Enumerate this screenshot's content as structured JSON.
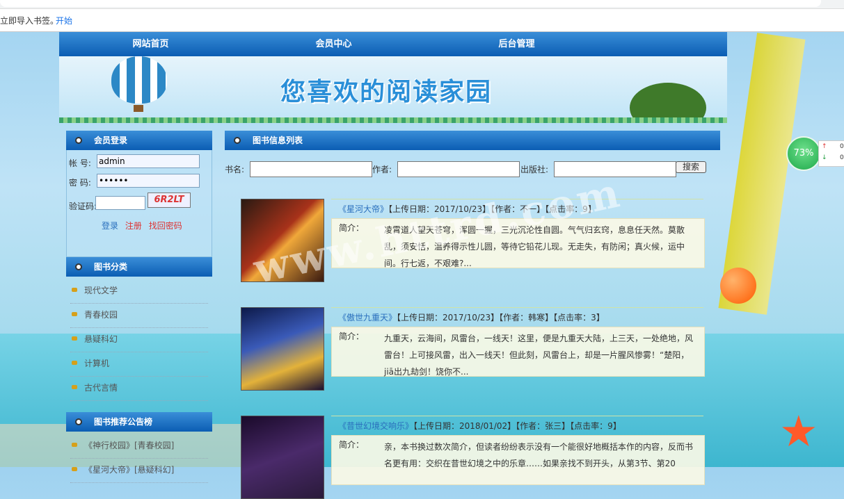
{
  "browser": {
    "bookmark_hint": "立即导入书签。",
    "bookmark_start": "开始"
  },
  "nav": [
    "网站首页",
    "会员中心",
    "后台管理"
  ],
  "banner": {
    "title": "您喜欢的阅读家园"
  },
  "login": {
    "panel_title": "会员登录",
    "account_label": "帐 号:",
    "account_value": "admin",
    "password_label": "密 码:",
    "password_value": "••••••",
    "captcha_label": "验证码:",
    "captcha_text": "6R2LT",
    "login_link": "登录",
    "register_link": "注册",
    "recover_link": "找回密码"
  },
  "categories": {
    "panel_title": "图书分类",
    "items": [
      "现代文学",
      "青春校园",
      "悬疑科幻",
      "计算机",
      "古代言情"
    ]
  },
  "recommend": {
    "panel_title": "图书推荐公告榜",
    "items": [
      "《神行校园》[青春校园]",
      "《星河大帝》[悬疑科幻]"
    ]
  },
  "main": {
    "panel_title": "图书信息列表",
    "search": {
      "name_label": "书名:",
      "author_label": "作者:",
      "publisher_label": "出版社:",
      "button": "搜索"
    },
    "books": [
      {
        "title": "《星河大帝》",
        "meta": "【上传日期：2017/10/23】【作者：不一】【点击率：9】",
        "intro_label": "简介：",
        "desc": "凌霄道人望天苍穹，浑圆一握，三光沉沦性自圆。气气归玄窍，息息任天然。莫散乱，须安恬，温养得示性儿圆，等待它铅花儿现。无走失，有防闲；真火候，运中间。行七返，不艰难?..."
      },
      {
        "title": "《傲世九重天》",
        "meta": "【上传日期：2017/10/23】【作者：韩寒】【点击率：3】",
        "intro_label": "简介：",
        "desc": "九重天，云海间，风雷台，一线天！这里，便是九重天大陆，上三天，一处绝地，风雷台！上可接风雷，出入一线天！但此刻，风雷台上，却是一片腥风惨雾！“楚阳，jiā出九劫剑！饶你不..."
      },
      {
        "title": "《昔世幻境交响乐》",
        "meta": "【上传日期：2018/01/02】【作者：张三】【点击率：9】",
        "intro_label": "简介：",
        "desc": "亲，本书换过数次简介，但读者纷纷表示没有一个能很好地概括本作的内容，反而书名更有用：交织在昔世幻境之中的乐章……如果亲找不到开头，从第3节、第20"
      }
    ]
  },
  "widget": {
    "percent": "73%",
    "up": "0",
    "down": "0"
  },
  "watermark": "www.httrd.com",
  "colors": {
    "nav": "#0b5db3",
    "link": "#2a6fbd",
    "accent_red": "#d33"
  }
}
